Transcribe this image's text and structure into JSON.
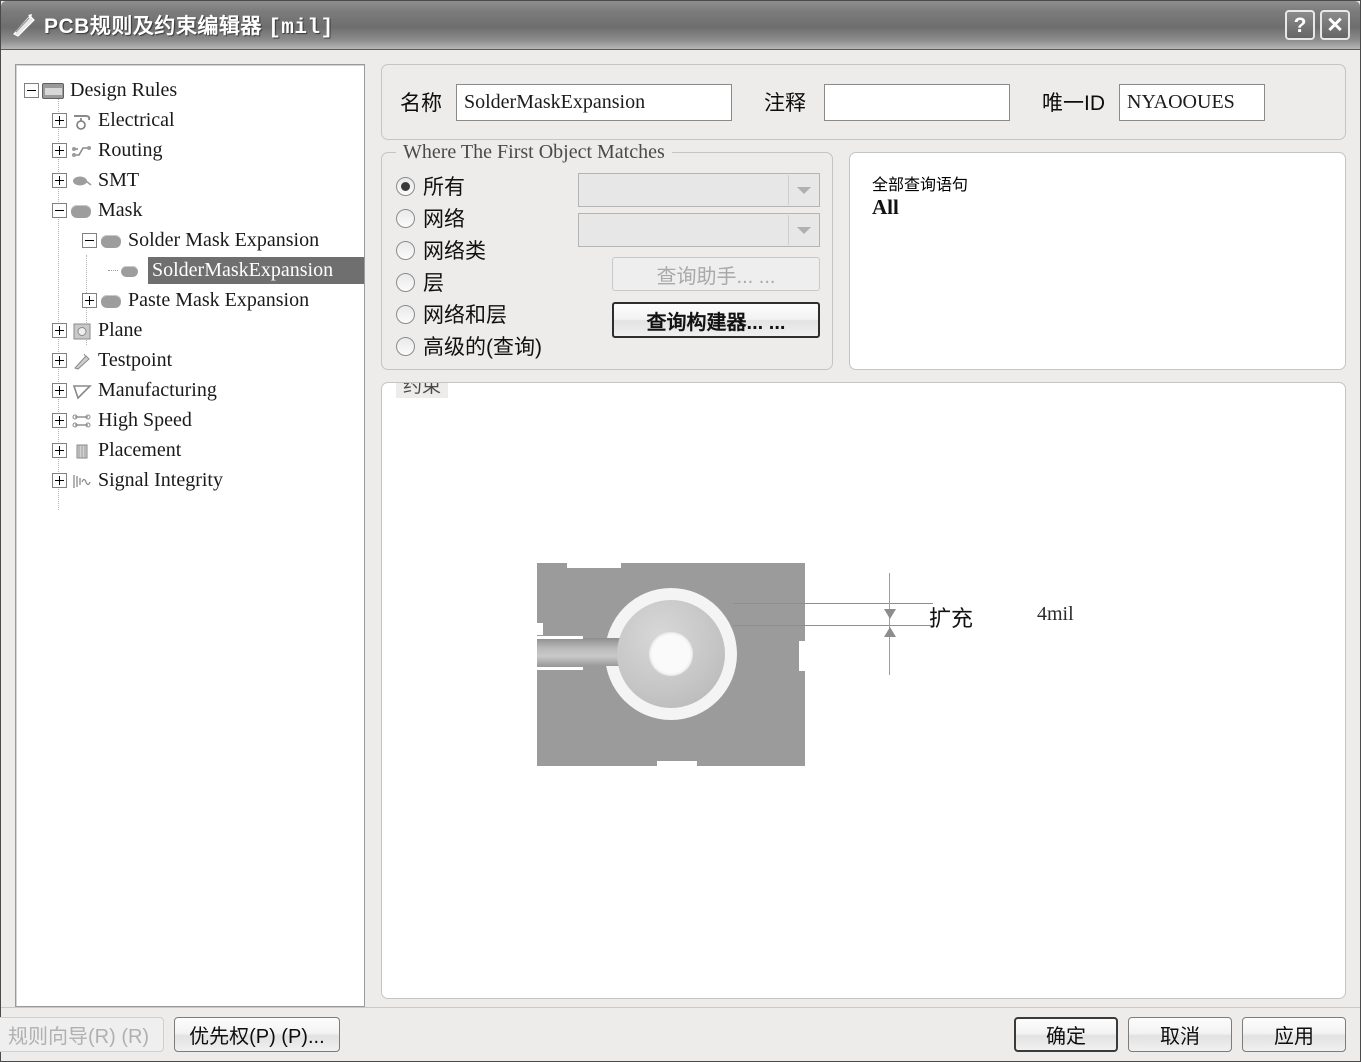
{
  "window": {
    "title": "PCB规则及约束编辑器",
    "unit": "[mil]",
    "icon": "pcb-rules-icon",
    "help_button": "?",
    "close_button": "✕"
  },
  "tree": {
    "items": [
      {
        "label": "Design Rules",
        "level": 0,
        "expander": "minus",
        "icon": "design-rules-folder-icon",
        "selected": false
      },
      {
        "label": "Electrical",
        "level": 1,
        "expander": "plus",
        "icon": "electrical-icon",
        "selected": false
      },
      {
        "label": "Routing",
        "level": 1,
        "expander": "plus",
        "icon": "routing-icon",
        "selected": false
      },
      {
        "label": "SMT",
        "level": 1,
        "expander": "plus",
        "icon": "smt-icon",
        "selected": false
      },
      {
        "label": "Mask",
        "level": 1,
        "expander": "minus",
        "icon": "mask-pill-icon",
        "selected": false
      },
      {
        "label": "Solder Mask Expansion",
        "level": 2,
        "expander": "minus",
        "icon": "mask-pill-icon",
        "selected": false
      },
      {
        "label": "SolderMaskExpansion",
        "level": 3,
        "expander": "none",
        "icon": "mask-pill-icon",
        "selected": true
      },
      {
        "label": "Paste Mask Expansion",
        "level": 2,
        "expander": "plus",
        "icon": "mask-pill-icon",
        "selected": false
      },
      {
        "label": "Plane",
        "level": 1,
        "expander": "plus",
        "icon": "plane-icon",
        "selected": false
      },
      {
        "label": "Testpoint",
        "level": 1,
        "expander": "plus",
        "icon": "testpoint-icon",
        "selected": false
      },
      {
        "label": "Manufacturing",
        "level": 1,
        "expander": "plus",
        "icon": "manufacturing-icon",
        "selected": false
      },
      {
        "label": "High Speed",
        "level": 1,
        "expander": "plus",
        "icon": "high-speed-icon",
        "selected": false
      },
      {
        "label": "Placement",
        "level": 1,
        "expander": "plus",
        "icon": "placement-icon",
        "selected": false
      },
      {
        "label": "Signal Integrity",
        "level": 1,
        "expander": "plus",
        "icon": "signal-integrity-icon",
        "selected": false
      }
    ]
  },
  "header": {
    "name_label": "名称",
    "name_value": "SolderMaskExpansion",
    "comment_label": "注释",
    "comment_value": "",
    "comment_placeholder": "",
    "unique_id_label": "唯一ID",
    "unique_id_value": "NYAOOUES"
  },
  "match": {
    "legend": "Where The First Object Matches",
    "options": [
      {
        "label": "所有",
        "selected": true
      },
      {
        "label": "网络",
        "selected": false
      },
      {
        "label": "网络类",
        "selected": false
      },
      {
        "label": "层",
        "selected": false
      },
      {
        "label": "网络和层",
        "selected": false
      },
      {
        "label": "高级的(查询)",
        "selected": false
      }
    ],
    "net_combo_value": "",
    "netclass_combo_value": "",
    "query_helper_button": "查询助手... ...",
    "query_builder_button": "查询构建器... ..."
  },
  "query": {
    "legend": "全部查询语句",
    "text": "All"
  },
  "constraint": {
    "legend": "约束",
    "expansion_label": "扩充",
    "expansion_value": "4mil"
  },
  "footer": {
    "rule_wizard_button": "规则向导(R) (R)",
    "priorities_button": "优先权(P) (P)...",
    "ok_button": "确定",
    "cancel_button": "取消",
    "apply_button": "应用"
  },
  "colors": {
    "titlebar": "#7b7b7b",
    "selection": "#6f6f6f",
    "dialog_bg": "#eeeceb",
    "board": "#9b9b9b",
    "mask": "#f4f4f4"
  }
}
